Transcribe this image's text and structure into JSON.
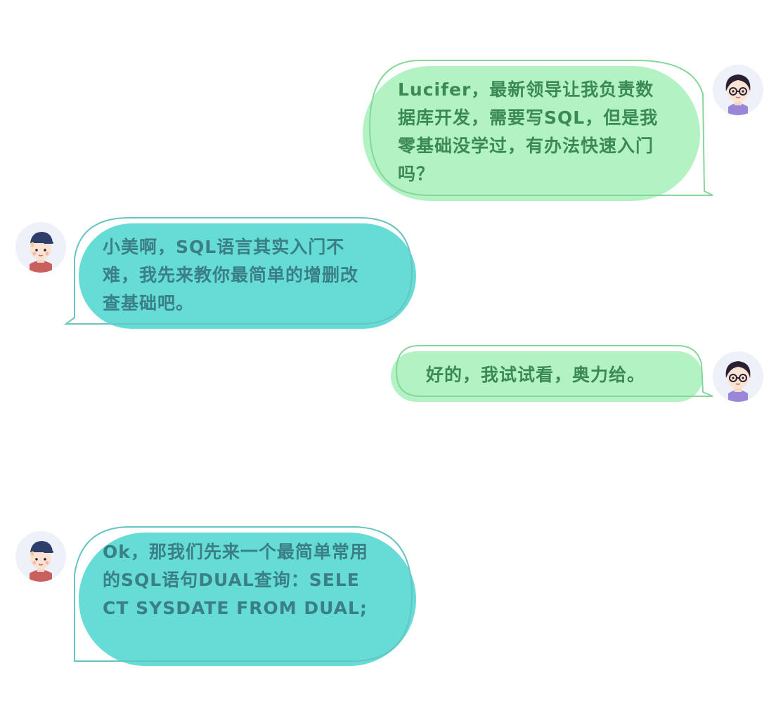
{
  "conversation": {
    "messages": [
      {
        "speaker": "xiaomei",
        "side": "right",
        "text": "Lucifer，最新领导让我负责数据库开发，需要写SQL，但是我零基础没学过，有办法快速入门吗？"
      },
      {
        "speaker": "lucifer",
        "side": "left",
        "text": "小美啊，SQL语言其实入门不难，我先来教你最简单的增删改查基础吧。"
      },
      {
        "speaker": "xiaomei",
        "side": "right",
        "text": "好的，我试试看，奥力给。"
      },
      {
        "speaker": "lucifer",
        "side": "left",
        "text": "Ok，那我们先来一个最简单常用的SQL语句DUAL查询：SELECT SYSDATE FROM DUAL;"
      }
    ]
  },
  "icons": {
    "female_avatar": "girl-with-glasses-avatar",
    "male_avatar": "boy-with-cap-avatar"
  },
  "colors": {
    "green_bubble_fill": "#b3f2c2",
    "green_bubble_outline": "#86d79b",
    "teal_bubble_fill": "#66dcd6",
    "teal_bubble_outline": "#67c4c0",
    "green_text": "#3b8a55",
    "teal_text": "#3a7f85",
    "avatar_bg": "#eef1f8"
  }
}
